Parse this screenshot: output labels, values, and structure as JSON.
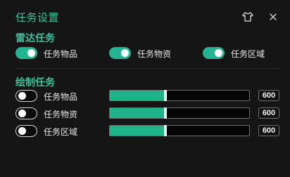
{
  "window": {
    "title": "任务设置"
  },
  "icons": {
    "shirt": "shirt-icon",
    "close": "close-icon"
  },
  "radar": {
    "title": "雷达任务",
    "items": [
      {
        "label": "任务物品",
        "enabled": true
      },
      {
        "label": "任务物资",
        "enabled": true
      },
      {
        "label": "任务区域",
        "enabled": true
      }
    ]
  },
  "draw": {
    "title": "绘制任务",
    "items": [
      {
        "label": "任务物品",
        "enabled": false,
        "value": "600",
        "fill_percent": 40
      },
      {
        "label": "任务物资",
        "enabled": false,
        "value": "600",
        "fill_percent": 40
      },
      {
        "label": "任务区域",
        "enabled": false,
        "value": "600",
        "fill_percent": 40
      }
    ]
  },
  "colors": {
    "accent": "#39c39a",
    "slider_fill": "#1fb38a",
    "background": "#151515"
  }
}
